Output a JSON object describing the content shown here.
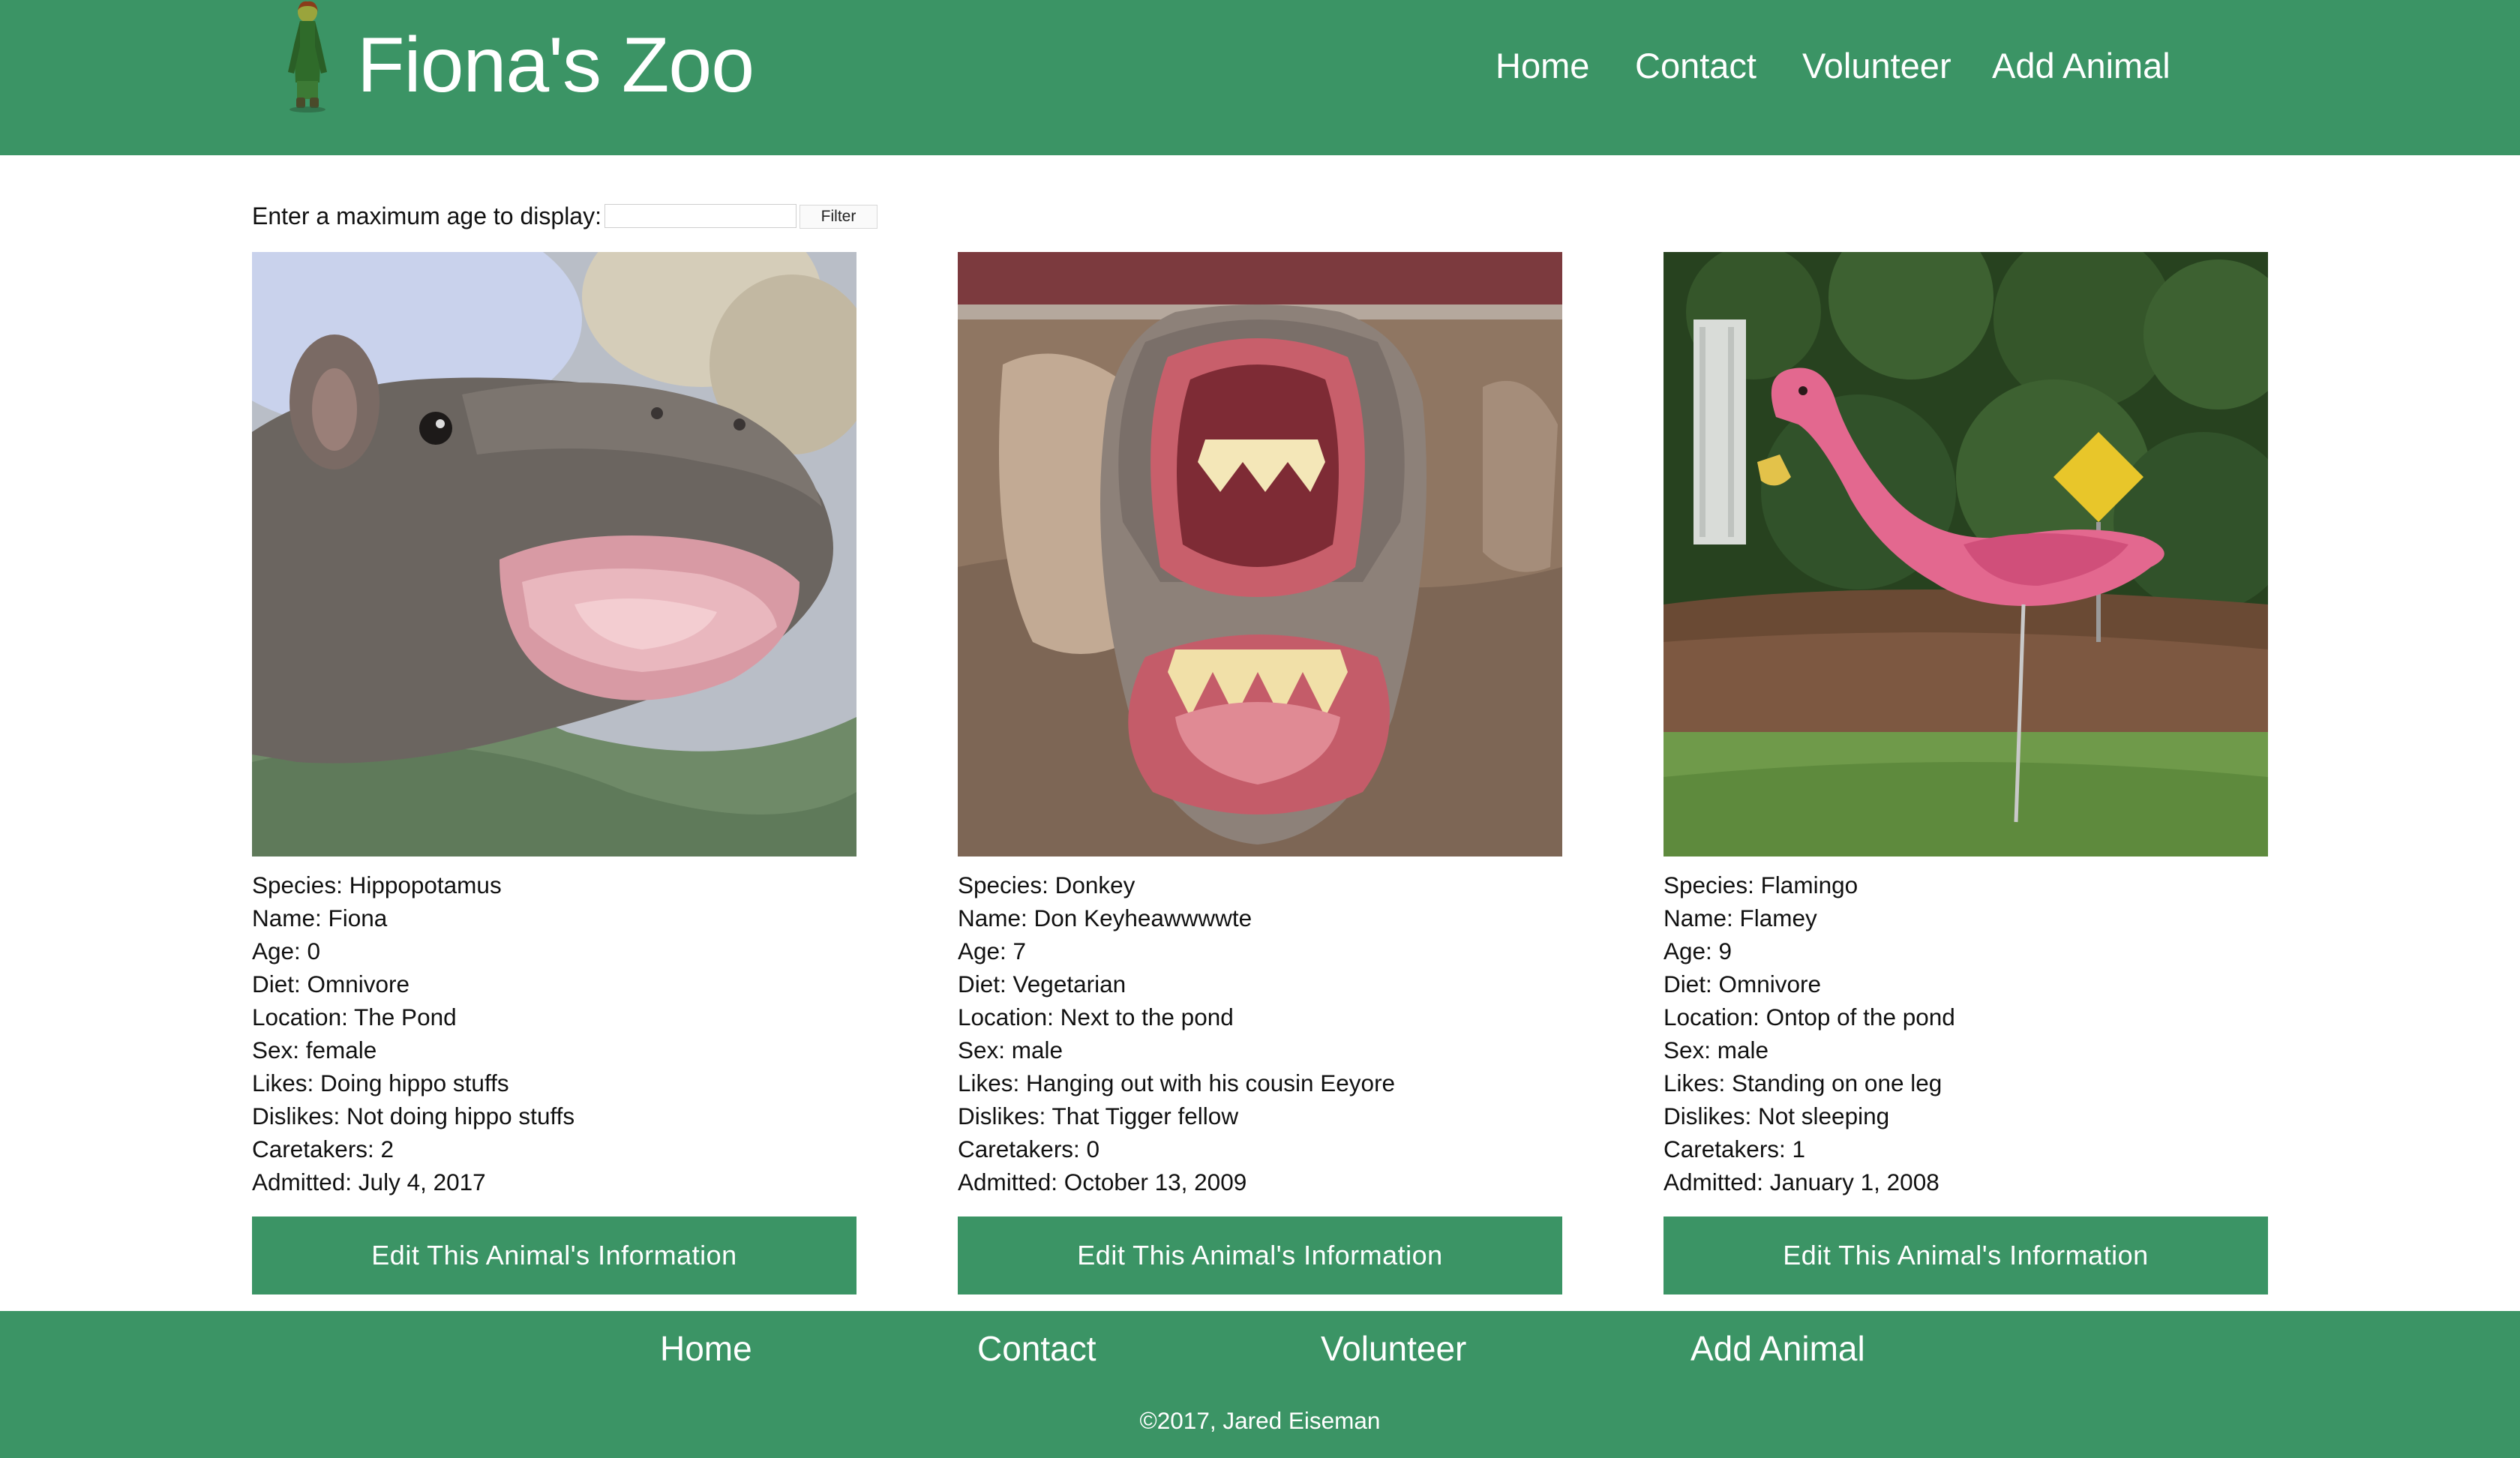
{
  "header": {
    "title": "Fiona's Zoo",
    "nav": [
      "Home",
      "Contact",
      "Volunteer",
      "Add Animal"
    ]
  },
  "filter": {
    "label": "Enter a maximum age to display:",
    "input_value": "",
    "button_label": "Filter"
  },
  "animals": [
    {
      "species": "Species: Hippopotamus",
      "name": "Name: Fiona",
      "age": "Age: 0",
      "diet": "Diet: Omnivore",
      "location": "Location: The Pond",
      "sex": "Sex: female",
      "likes": "Likes: Doing hippo stuffs",
      "dislikes": "Dislikes: Not doing hippo stuffs",
      "caretakers": "Caretakers: 2",
      "admitted": "Admitted: July 4, 2017",
      "edit_label": "Edit This Animal's Information"
    },
    {
      "species": "Species: Donkey",
      "name": "Name: Don Keyheawwwwte",
      "age": "Age: 7",
      "diet": "Diet: Vegetarian",
      "location": "Location: Next to the pond",
      "sex": "Sex: male",
      "likes": "Likes: Hanging out with his cousin Eeyore",
      "dislikes": "Dislikes: That Tigger fellow",
      "caretakers": "Caretakers: 0",
      "admitted": "Admitted: October 13, 2009",
      "edit_label": "Edit This Animal's Information"
    },
    {
      "species": "Species: Flamingo",
      "name": "Name: Flamey",
      "age": "Age: 9",
      "diet": "Diet: Omnivore",
      "location": "Location: Ontop of the pond",
      "sex": "Sex: male",
      "likes": "Likes: Standing on one leg",
      "dislikes": "Dislikes: Not sleeping",
      "caretakers": "Caretakers: 1",
      "admitted": "Admitted: January 1, 2008",
      "edit_label": "Edit This Animal's Information"
    }
  ],
  "footer": {
    "nav": [
      "Home",
      "Contact",
      "Volunteer",
      "Add Animal"
    ],
    "copyright": "©2017, Jared Eiseman"
  },
  "colors": {
    "brand_green": "#3b9465",
    "text": "#111111",
    "background": "#ffffff"
  },
  "icons": {
    "logo": "fiona-figure-logo"
  }
}
